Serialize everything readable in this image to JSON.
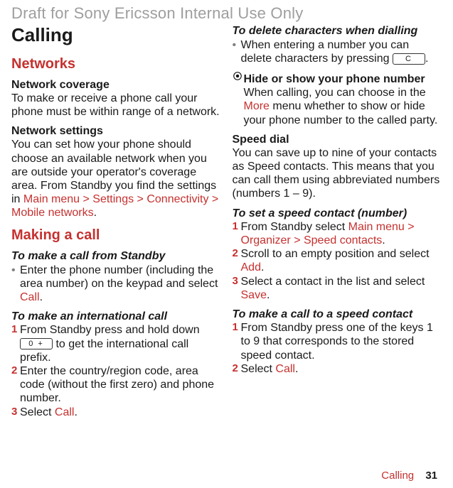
{
  "header": {
    "draft": "Draft for Sony Ericsson Internal Use Only"
  },
  "left": {
    "title": "Calling",
    "networks_heading": "Networks",
    "network_coverage_heading": "Network coverage",
    "network_coverage_body": "To make or receive a phone call your phone must be within range of a network.",
    "network_settings_heading": "Network settings",
    "network_settings_body_pre": "You can set how your phone should choose an available network when you are outside your operator's coverage area. From Standby you find the settings in ",
    "network_settings_path": "Main menu > Settings > Connectivity > Mobile networks",
    "network_settings_body_post": ".",
    "making_call_heading": "Making a call",
    "standby_call_heading": "To make a call from Standby",
    "standby_call_step1_pre": "Enter the phone number (including the area number) on the keypad and select ",
    "standby_call_step1_action": "Call",
    "standby_call_step1_post": ".",
    "intl_call_heading": "To make an international call",
    "intl_step1_pre": "From Standby press and hold down ",
    "intl_step1_key": "0 +",
    "intl_step1_post": " to get the international call prefix.",
    "intl_step2": "Enter the country/region code, area code (without the first zero) and phone number.",
    "intl_step3_pre": "Select ",
    "intl_step3_action": "Call",
    "intl_step3_post": "."
  },
  "right": {
    "delete_heading": "To delete characters when dialling",
    "delete_body_pre": "When entering a number you can delete characters by pressing ",
    "delete_key": "C",
    "delete_body_post": ".",
    "hide_heading": "Hide or show your phone number",
    "hide_body_pre": "When calling, you can choose in the ",
    "hide_body_action": "More",
    "hide_body_post": " menu whether to show or hide your phone number to the called party.",
    "speed_heading": "Speed dial",
    "speed_body": "You can save up to nine of your contacts as Speed contacts. This means that you can call them using abbreviated numbers (numbers 1 – 9).",
    "set_speed_heading": "To set a speed contact (number)",
    "set_speed_step1_pre": "From Standby select ",
    "set_speed_step1_action": "Main menu > Organizer > Speed contacts",
    "set_speed_step1_post": ".",
    "set_speed_step2_pre": "Scroll to an empty position and select ",
    "set_speed_step2_action": "Add",
    "set_speed_step2_post": ".",
    "set_speed_step3_pre": "Select a contact in the list and select ",
    "set_speed_step3_action": "Save",
    "set_speed_step3_post": ".",
    "call_speed_heading": "To make a call to a speed contact",
    "call_speed_step1": "From Standby press one of the keys 1 to 9 that corresponds to the stored speed contact.",
    "call_speed_step2_pre": "Select ",
    "call_speed_step2_action": "Call",
    "call_speed_step2_post": "."
  },
  "footer": {
    "label": "Calling",
    "page": "31"
  },
  "markers": {
    "1": "1",
    "2": "2",
    "3": "3",
    "bullet": "•"
  }
}
